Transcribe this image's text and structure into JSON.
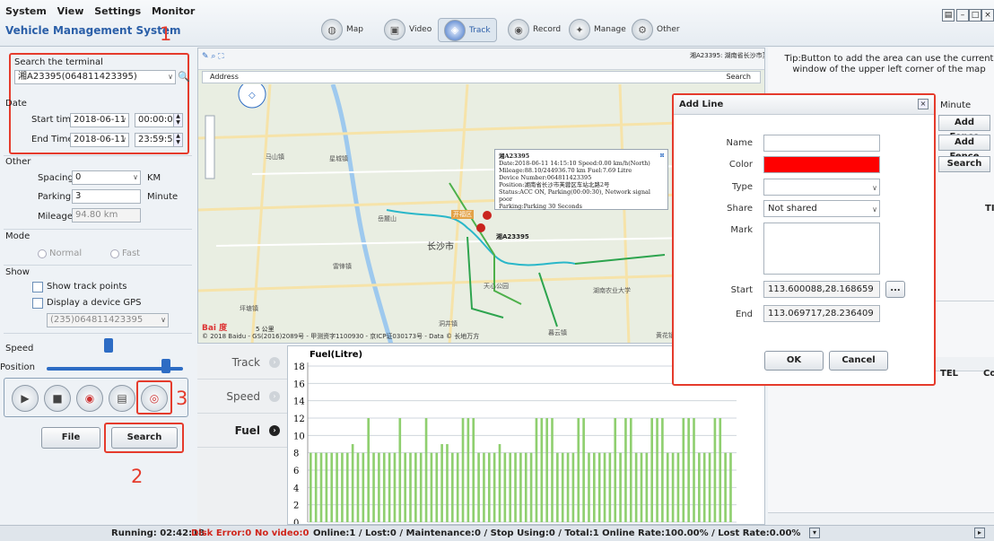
{
  "menu": {
    "items": [
      "System",
      "View",
      "Settings",
      "Monitor"
    ],
    "system_name": "Vehicle Management System"
  },
  "annotations": {
    "n1": "1",
    "n2": "2",
    "n3": "3"
  },
  "nav": [
    {
      "label": "Map",
      "icon": "map-icon"
    },
    {
      "label": "Video",
      "icon": "video-icon"
    },
    {
      "label": "Track",
      "icon": "track-icon"
    },
    {
      "label": "Record",
      "icon": "record-icon"
    },
    {
      "label": "Manage",
      "icon": "manage-icon"
    },
    {
      "label": "Other",
      "icon": "other-icon"
    }
  ],
  "left": {
    "search_terminal_label": "Search the terminal",
    "terminal_value": "湘A23395(064811423395)",
    "date_label": "Date",
    "start_label": "Start time",
    "start_date": "2018-06-11",
    "start_time": "00:00:00",
    "end_label": "End Time",
    "end_date": "2018-06-11",
    "end_time": "23:59:59",
    "other_label": "Other",
    "spacing_label": "Spacing",
    "spacing_value": "0",
    "spacing_unit": "KM",
    "parking_label": "Parking",
    "parking_value": "3",
    "parking_unit": "Minute",
    "mileage_label": "Mileage",
    "mileage_value": "94.80 km",
    "mode_label": "Mode",
    "mode_normal": "Normal",
    "mode_fast": "Fast",
    "show_label": "Show",
    "show_track_points": "Show track points",
    "display_gps": "Display a device GPS",
    "gps_device": "(235)064811423395",
    "speed_label": "Speed",
    "position_label": "Position",
    "speed_level": 0.35,
    "position_level": 0.9,
    "file_btn": "File",
    "search_btn": "Search"
  },
  "map": {
    "info": "湘A23395: 湖南省长沙市芙蓉区车站北路2号",
    "address_label": "Address",
    "search_label": "Search",
    "popup": {
      "plate": "湘A23395",
      "line1": "Date:2018-06-11 14:15:10    Speed:0.00 km/h(North)",
      "line2": "Mileage:88.10/244936.70 km    Fuel:7.69 Litre",
      "line3": "Device Number:064811423395",
      "line4": "Position:湖南省长沙市芙蓉区车站北路2号",
      "line5": "Status:ACC ON, Parking(00:00:30), Network signal poor",
      "line6": "Parking:Parking 30 Seconds"
    },
    "marker_label": "湘A23395",
    "place_names": [
      "马山镇",
      "星城镇",
      "长沙市",
      "雷锋镇",
      "天心公园",
      "岳麓山",
      "开福区",
      "湖南农业大学",
      "黄花镇",
      "坪塘镇",
      "洞井镇",
      "暮云镇"
    ],
    "scale": "5 公里",
    "copyright": "© 2018 Baidu - GS(2016)2089号 - 甲测资字1100930 - 京ICP证030173号 - Data © 长地万方",
    "baidu_logo": "Bai 度"
  },
  "tabs": [
    {
      "label": "Track"
    },
    {
      "label": "Speed"
    },
    {
      "label": "Fuel"
    }
  ],
  "chart_data": {
    "type": "bar",
    "title": "Fuel(Litre)",
    "ylim": [
      0,
      18
    ],
    "yticks": [
      0,
      2,
      4,
      6,
      8,
      10,
      12,
      14,
      16,
      18
    ],
    "grid": true,
    "color": "#8fcf6f",
    "values": [
      8,
      8,
      8,
      8,
      8,
      8,
      8,
      8,
      9,
      8,
      8,
      12,
      8,
      8,
      8,
      8,
      8,
      12,
      8,
      8,
      8,
      8,
      12,
      8,
      8,
      9,
      9,
      8,
      8,
      12,
      12,
      12,
      8,
      8,
      8,
      8,
      9,
      8,
      8,
      8,
      8,
      8,
      8,
      12,
      12,
      12,
      12,
      8,
      8,
      8,
      8,
      12,
      12,
      8,
      8,
      8,
      8,
      8,
      12,
      8,
      12,
      12,
      8,
      8,
      8,
      12,
      12,
      12,
      8,
      8,
      8,
      12,
      12,
      12,
      8,
      8,
      8,
      12,
      12,
      8,
      8
    ]
  },
  "right": {
    "tip": "Tip:Button to add the area can use the current window of the upper left corner of the map",
    "minute": "Minute",
    "add_fence_1": "Add Fence",
    "add_fence_2": "Add Fence",
    "search": "Search",
    "col_te": "TI",
    "col_tel": "TEL",
    "col_c": "Co"
  },
  "dialog": {
    "title": "Add Line",
    "name_label": "Name",
    "name_value": "",
    "color_label": "Color",
    "color_value": "#ff0000",
    "type_label": "Type",
    "type_value": "",
    "share_label": "Share",
    "share_value": "Not shared",
    "mark_label": "Mark",
    "mark_value": "",
    "start_label": "Start",
    "start_value": "113.600088,28.168659",
    "end_label": "End",
    "end_value": "113.069717,28.236409",
    "browse": "...",
    "ok": "OK",
    "cancel": "Cancel"
  },
  "status": {
    "running": "Running: 02:42:18",
    "disk_error": "Disk Error:0",
    "no_video": "No video:0",
    "rest": "Online:1 / Lost:0 / Maintenance:0 / Stop Using:0 / Total:1   Online Rate:100.00% / Lost Rate:0.00%"
  }
}
